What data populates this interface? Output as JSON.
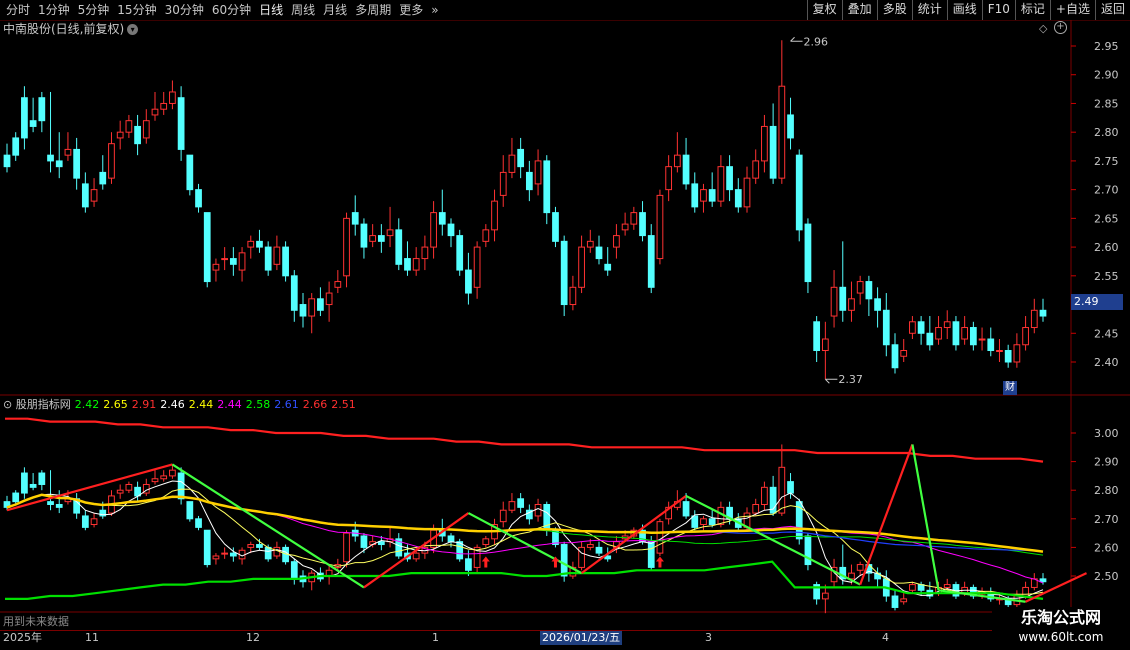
{
  "toolbar": {
    "periods": [
      "分时",
      "1分钟",
      "5分钟",
      "15分钟",
      "30分钟",
      "60分钟",
      "日线",
      "周线",
      "月线",
      "多周期",
      "更多"
    ],
    "active_period": "日线",
    "buttons": [
      "复权",
      "叠加",
      "多股",
      "统计",
      "画线",
      "F10",
      "标记",
      "+自选",
      "返回"
    ]
  },
  "main_chart": {
    "title": "中南股份(日线,前复权)",
    "high_label": "2.96",
    "low_label": "2.37",
    "current_price": "2.49",
    "finance_badge": "财",
    "y_ticks": [
      "2.95",
      "2.90",
      "2.85",
      "2.80",
      "2.75",
      "2.70",
      "2.65",
      "2.60",
      "2.55",
      "2.50",
      "2.45",
      "2.40"
    ]
  },
  "indicator": {
    "name": "股朋指标网",
    "values": [
      "2.42",
      "2.65",
      "2.91",
      "2.46",
      "2.44",
      "2.44",
      "2.58",
      "2.61",
      "2.66",
      "2.51"
    ],
    "value_colors": [
      "#00ff00",
      "#ffff00",
      "#ff3030",
      "#ffffff",
      "#ffff00",
      "#ff00ff",
      "#00ff00",
      "#3050ff",
      "#ff3030",
      "#ff3030"
    ],
    "y_ticks": [
      "3.00",
      "2.90",
      "2.80",
      "2.70",
      "2.60",
      "2.50"
    ],
    "future_label": "用到未来数据"
  },
  "date_axis": {
    "labels": [
      "2025年",
      "11",
      "12",
      "1",
      "2026/01/23/五",
      "3",
      "4"
    ]
  },
  "watermark": {
    "line1": "乐淘公式网",
    "line2": "www.60lt.com"
  },
  "colors": {
    "up": "#ff3232",
    "down": "#54ffff",
    "grid": "#7a0000"
  },
  "chart_data": {
    "type": "candlestick",
    "ylim": [
      2.35,
      2.98
    ],
    "candles": [
      [
        2.76,
        2.78,
        2.74,
        2.73
      ],
      [
        2.79,
        2.8,
        2.76,
        2.75
      ],
      [
        2.86,
        2.88,
        2.79,
        2.77
      ],
      [
        2.82,
        2.86,
        2.81,
        2.8
      ],
      [
        2.86,
        2.87,
        2.82,
        2.8
      ],
      [
        2.76,
        2.87,
        2.75,
        2.73
      ],
      [
        2.75,
        2.8,
        2.74,
        2.72
      ],
      [
        2.76,
        2.8,
        2.77,
        2.75
      ],
      [
        2.77,
        2.79,
        2.72,
        2.7
      ],
      [
        2.71,
        2.73,
        2.67,
        2.66
      ],
      [
        2.68,
        2.72,
        2.7,
        2.67
      ],
      [
        2.73,
        2.76,
        2.71,
        2.7
      ],
      [
        2.72,
        2.8,
        2.78,
        2.71
      ],
      [
        2.79,
        2.82,
        2.8,
        2.77
      ],
      [
        2.8,
        2.83,
        2.82,
        2.79
      ],
      [
        2.81,
        2.83,
        2.78,
        2.76
      ],
      [
        2.79,
        2.84,
        2.82,
        2.78
      ],
      [
        2.83,
        2.87,
        2.84,
        2.82
      ],
      [
        2.84,
        2.87,
        2.85,
        2.83
      ],
      [
        2.85,
        2.89,
        2.87,
        2.84
      ],
      [
        2.86,
        2.88,
        2.77,
        2.75
      ],
      [
        2.76,
        2.76,
        2.7,
        2.69
      ],
      [
        2.7,
        2.71,
        2.67,
        2.66
      ],
      [
        2.66,
        2.66,
        2.54,
        2.53
      ],
      [
        2.56,
        2.58,
        2.57,
        2.54
      ],
      [
        2.58,
        2.6,
        2.58,
        2.56
      ],
      [
        2.58,
        2.6,
        2.57,
        2.55
      ],
      [
        2.56,
        2.6,
        2.59,
        2.54
      ],
      [
        2.6,
        2.62,
        2.61,
        2.58
      ],
      [
        2.61,
        2.63,
        2.6,
        2.59
      ],
      [
        2.6,
        2.61,
        2.56,
        2.55
      ],
      [
        2.57,
        2.62,
        2.6,
        2.56
      ],
      [
        2.6,
        2.61,
        2.55,
        2.54
      ],
      [
        2.55,
        2.56,
        2.49,
        2.47
      ],
      [
        2.5,
        2.52,
        2.48,
        2.46
      ],
      [
        2.48,
        2.52,
        2.51,
        2.45
      ],
      [
        2.51,
        2.53,
        2.49,
        2.48
      ],
      [
        2.5,
        2.54,
        2.52,
        2.47
      ],
      [
        2.53,
        2.56,
        2.54,
        2.52
      ],
      [
        2.55,
        2.66,
        2.65,
        2.53
      ],
      [
        2.66,
        2.69,
        2.64,
        2.62
      ],
      [
        2.64,
        2.65,
        2.6,
        2.58
      ],
      [
        2.61,
        2.64,
        2.62,
        2.6
      ],
      [
        2.62,
        2.64,
        2.61,
        2.59
      ],
      [
        2.62,
        2.67,
        2.63,
        2.6
      ],
      [
        2.63,
        2.65,
        2.57,
        2.56
      ],
      [
        2.58,
        2.61,
        2.56,
        2.55
      ],
      [
        2.56,
        2.6,
        2.58,
        2.55
      ],
      [
        2.58,
        2.62,
        2.6,
        2.56
      ],
      [
        2.6,
        2.68,
        2.66,
        2.58
      ],
      [
        2.66,
        2.7,
        2.64,
        2.62
      ],
      [
        2.64,
        2.65,
        2.62,
        2.6
      ],
      [
        2.62,
        2.63,
        2.56,
        2.55
      ],
      [
        2.56,
        2.59,
        2.52,
        2.5
      ],
      [
        2.53,
        2.61,
        2.6,
        2.51
      ],
      [
        2.61,
        2.64,
        2.63,
        2.6
      ],
      [
        2.63,
        2.7,
        2.68,
        2.61
      ],
      [
        2.69,
        2.76,
        2.73,
        2.67
      ],
      [
        2.73,
        2.79,
        2.76,
        2.72
      ],
      [
        2.77,
        2.79,
        2.74,
        2.72
      ],
      [
        2.73,
        2.75,
        2.7,
        2.68
      ],
      [
        2.71,
        2.77,
        2.75,
        2.69
      ],
      [
        2.75,
        2.76,
        2.66,
        2.64
      ],
      [
        2.66,
        2.67,
        2.61,
        2.6
      ],
      [
        2.61,
        2.62,
        2.5,
        2.48
      ],
      [
        2.5,
        2.55,
        2.53,
        2.49
      ],
      [
        2.53,
        2.62,
        2.6,
        2.52
      ],
      [
        2.6,
        2.63,
        2.61,
        2.59
      ],
      [
        2.6,
        2.62,
        2.58,
        2.57
      ],
      [
        2.57,
        2.6,
        2.56,
        2.55
      ],
      [
        2.6,
        2.64,
        2.62,
        2.58
      ],
      [
        2.63,
        2.66,
        2.64,
        2.62
      ],
      [
        2.64,
        2.67,
        2.66,
        2.63
      ],
      [
        2.66,
        2.68,
        2.62,
        2.61
      ],
      [
        2.62,
        2.64,
        2.53,
        2.52
      ],
      [
        2.58,
        2.7,
        2.69,
        2.57
      ],
      [
        2.7,
        2.76,
        2.74,
        2.68
      ],
      [
        2.74,
        2.8,
        2.76,
        2.73
      ],
      [
        2.76,
        2.79,
        2.71,
        2.7
      ],
      [
        2.71,
        2.73,
        2.67,
        2.66
      ],
      [
        2.68,
        2.71,
        2.7,
        2.66
      ],
      [
        2.7,
        2.73,
        2.68,
        2.67
      ],
      [
        2.68,
        2.76,
        2.74,
        2.67
      ],
      [
        2.74,
        2.76,
        2.7,
        2.68
      ],
      [
        2.7,
        2.72,
        2.67,
        2.66
      ],
      [
        2.67,
        2.74,
        2.72,
        2.66
      ],
      [
        2.72,
        2.77,
        2.75,
        2.71
      ],
      [
        2.75,
        2.83,
        2.81,
        2.73
      ],
      [
        2.81,
        2.85,
        2.72,
        2.71
      ],
      [
        2.72,
        2.96,
        2.88,
        2.71
      ],
      [
        2.83,
        2.86,
        2.79,
        2.77
      ],
      [
        2.76,
        2.77,
        2.63,
        2.61
      ],
      [
        2.64,
        2.65,
        2.54,
        2.52
      ],
      [
        2.47,
        2.48,
        2.42,
        2.4
      ],
      [
        2.42,
        2.47,
        2.44,
        2.37
      ],
      [
        2.48,
        2.56,
        2.53,
        2.46
      ],
      [
        2.53,
        2.61,
        2.49,
        2.47
      ],
      [
        2.49,
        2.54,
        2.51,
        2.47
      ],
      [
        2.52,
        2.55,
        2.54,
        2.5
      ],
      [
        2.54,
        2.55,
        2.51,
        2.48
      ],
      [
        2.51,
        2.53,
        2.49,
        2.46
      ],
      [
        2.49,
        2.52,
        2.43,
        2.41
      ],
      [
        2.43,
        2.45,
        2.39,
        2.38
      ],
      [
        2.41,
        2.44,
        2.42,
        2.4
      ],
      [
        2.45,
        2.48,
        2.47,
        2.44
      ],
      [
        2.47,
        2.48,
        2.45,
        2.43
      ],
      [
        2.45,
        2.48,
        2.43,
        2.42
      ],
      [
        2.44,
        2.48,
        2.46,
        2.43
      ],
      [
        2.46,
        2.49,
        2.47,
        2.44
      ],
      [
        2.47,
        2.48,
        2.43,
        2.42
      ],
      [
        2.44,
        2.48,
        2.46,
        2.43
      ],
      [
        2.46,
        2.47,
        2.43,
        2.42
      ],
      [
        2.44,
        2.46,
        2.44,
        2.42
      ],
      [
        2.44,
        2.46,
        2.42,
        2.41
      ],
      [
        2.42,
        2.44,
        2.42,
        2.4
      ],
      [
        2.42,
        2.43,
        2.4,
        2.39
      ],
      [
        2.4,
        2.45,
        2.43,
        2.39
      ],
      [
        2.43,
        2.48,
        2.46,
        2.42
      ],
      [
        2.46,
        2.51,
        2.49,
        2.45
      ],
      [
        2.49,
        2.51,
        2.48,
        2.47
      ]
    ],
    "indicator_lines": {
      "red_upper": [
        3.05,
        3.05,
        3.04,
        3.04,
        3.04,
        3.03,
        3.03,
        3.02,
        3.02,
        3.02,
        3.01,
        3.01,
        3.0,
        3.0,
        3.0,
        2.99,
        2.99,
        2.98,
        2.98,
        2.98,
        2.97,
        2.97,
        2.96,
        2.96,
        2.96,
        2.96,
        2.95,
        2.95,
        2.95,
        2.95,
        2.95,
        2.94,
        2.94,
        2.94,
        2.94,
        2.94,
        2.93,
        2.93,
        2.93,
        2.93,
        2.93,
        2.92,
        2.92,
        2.91,
        2.91,
        2.91,
        2.9
      ],
      "green_lower": [
        2.42,
        2.42,
        2.43,
        2.43,
        2.44,
        2.45,
        2.46,
        2.47,
        2.47,
        2.48,
        2.48,
        2.49,
        2.49,
        2.49,
        2.5,
        2.5,
        2.5,
        2.5,
        2.51,
        2.51,
        2.51,
        2.51,
        2.51,
        2.5,
        2.5,
        2.51,
        2.51,
        2.51,
        2.52,
        2.52,
        2.52,
        2.52,
        2.53,
        2.54,
        2.55,
        2.46,
        2.46,
        2.46,
        2.46,
        2.46,
        2.44,
        2.44,
        2.44,
        2.44,
        2.44,
        2.43,
        2.42
      ],
      "zigzag_x": [
        0,
        19,
        41,
        53,
        66,
        78,
        98,
        104,
        107,
        117,
        124
      ],
      "zigzag_y": [
        2.73,
        2.89,
        2.46,
        2.72,
        2.51,
        2.78,
        2.47,
        2.96,
        2.45,
        2.41,
        2.51
      ]
    }
  }
}
